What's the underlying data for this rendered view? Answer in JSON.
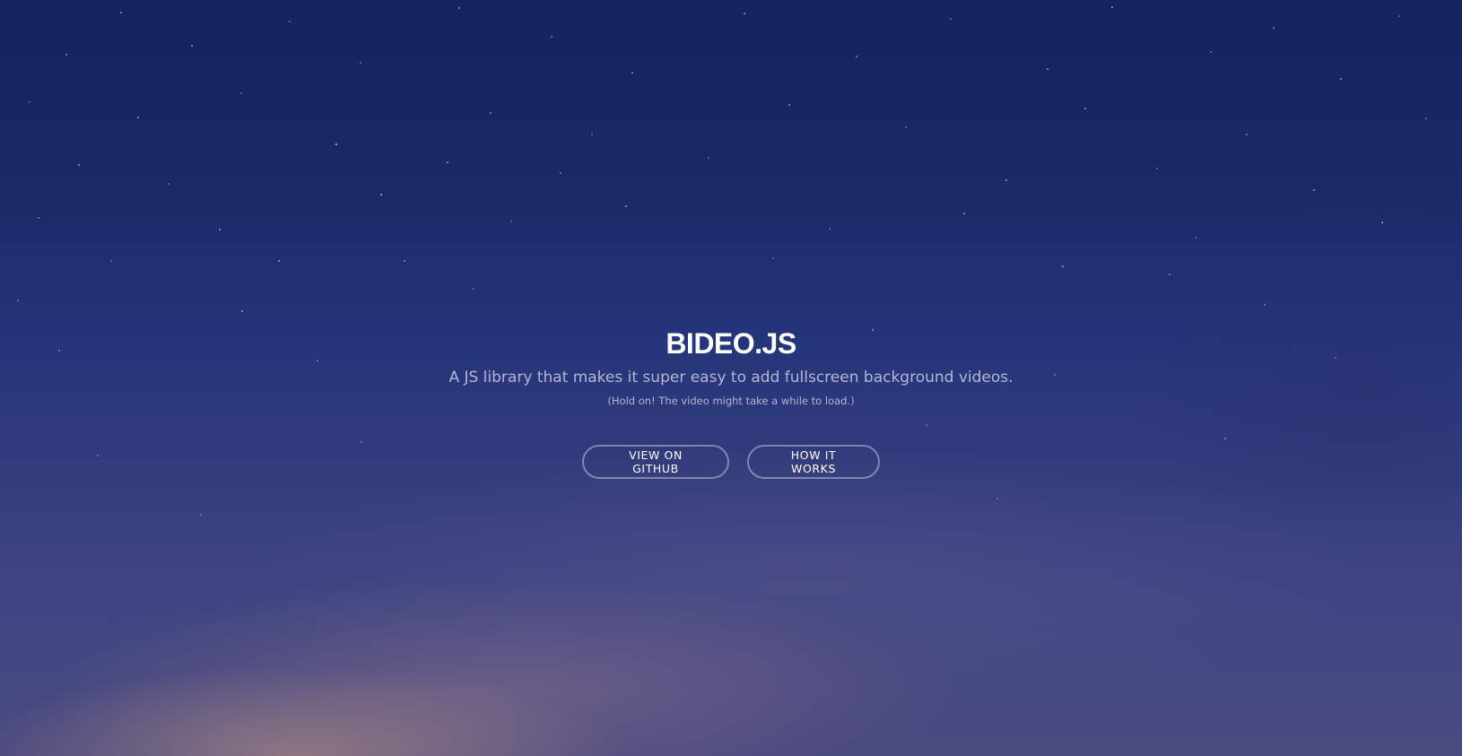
{
  "hero": {
    "title": "BIDEO.JS",
    "subtitle": "A JS library that makes it super easy to add fullscreen background videos.",
    "note": "(Hold on! The video might take a while to load.)"
  },
  "buttons": {
    "github_label": "VIEW ON GITHUB",
    "how_label": "HOW IT WORKS"
  },
  "colors": {
    "sky_top": "#15235f",
    "sky_bottom": "#4a4a80",
    "horizon_glow": "#be9682",
    "text_primary": "#ffffff",
    "text_secondary": "#b3b6d6"
  }
}
